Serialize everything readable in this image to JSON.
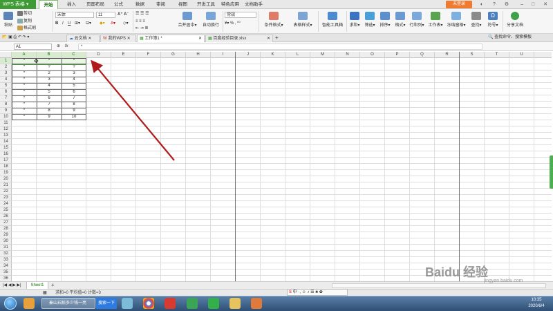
{
  "app": {
    "name": "WPS 表格",
    "login": "未登录"
  },
  "menu": [
    "开始",
    "插入",
    "页面布局",
    "公式",
    "数据",
    "审阅",
    "视图",
    "开发工具",
    "特色应用",
    "文档助手"
  ],
  "ribbon": {
    "paste": "粘贴",
    "cut": "剪切",
    "copy": "复制",
    "format_painter": "格式刷",
    "font": "宋体",
    "font_size": "11",
    "merge": "合并居中",
    "wrap": "自动换行",
    "number_format": "常规",
    "cond_format": "条件格式",
    "table_style": "表格样式",
    "smart_tools": "智能工具箱",
    "sum": "求和",
    "filter": "筛选",
    "sort": "排序",
    "format": "格式",
    "row_col": "行和列",
    "worksheet": "工作表",
    "freeze": "冻结窗格",
    "find": "查找",
    "symbol": "符号",
    "share": "分享文档",
    "search_hint": "查找命令、搜索模板"
  },
  "doc_tabs": [
    "云文档",
    "我的WPS",
    "工作簿1 *",
    "百度经验目录.xlsx"
  ],
  "formula_bar": {
    "name_box": "A1",
    "fx": "fx",
    "value": "*"
  },
  "columns": [
    "A",
    "B",
    "C",
    "D",
    "E",
    "F",
    "G",
    "H",
    "I",
    "J",
    "K",
    "L",
    "M",
    "N",
    "O",
    "P",
    "Q",
    "R",
    "S",
    "T",
    "U"
  ],
  "rows": [
    "1",
    "2",
    "3",
    "4",
    "5",
    "6",
    "7",
    "8",
    "9",
    "10",
    "11",
    "12",
    "13",
    "14",
    "15",
    "16",
    "17",
    "18",
    "19",
    "20",
    "21",
    "22",
    "23",
    "24",
    "25",
    "26",
    "27",
    "28",
    "29",
    "30",
    "31",
    "32",
    "33",
    "34",
    "35",
    "36"
  ],
  "table": [
    [
      "*",
      "*",
      "*"
    ],
    [
      "*",
      "?",
      "?"
    ],
    [
      "*",
      "2",
      "3"
    ],
    [
      "*",
      "3",
      "4"
    ],
    [
      "*",
      "4",
      "5"
    ],
    [
      "*",
      "5",
      "6"
    ],
    [
      "*",
      "6",
      "7"
    ],
    [
      "*",
      "7",
      "8"
    ],
    [
      "*",
      "8",
      "9"
    ],
    [
      "*",
      "9",
      "10"
    ]
  ],
  "sheet_tab": "Sheet1",
  "status": "求和=0  平均值=0  计数=3",
  "ime": "中 ·, ☺ ♪ ☰ ♣ ✿",
  "taskbar": {
    "task": "秦山石斛多少钱一亮",
    "search": "搜索一下",
    "time": "10:35",
    "date": "2020/6/4"
  },
  "watermark": "Baidu 经验",
  "watermark_sub": "jingyan.baidu.com",
  "colors": {
    "accent": "#3f9b34",
    "arrow": "#b01c1c",
    "selection": "#3d9a2e"
  }
}
